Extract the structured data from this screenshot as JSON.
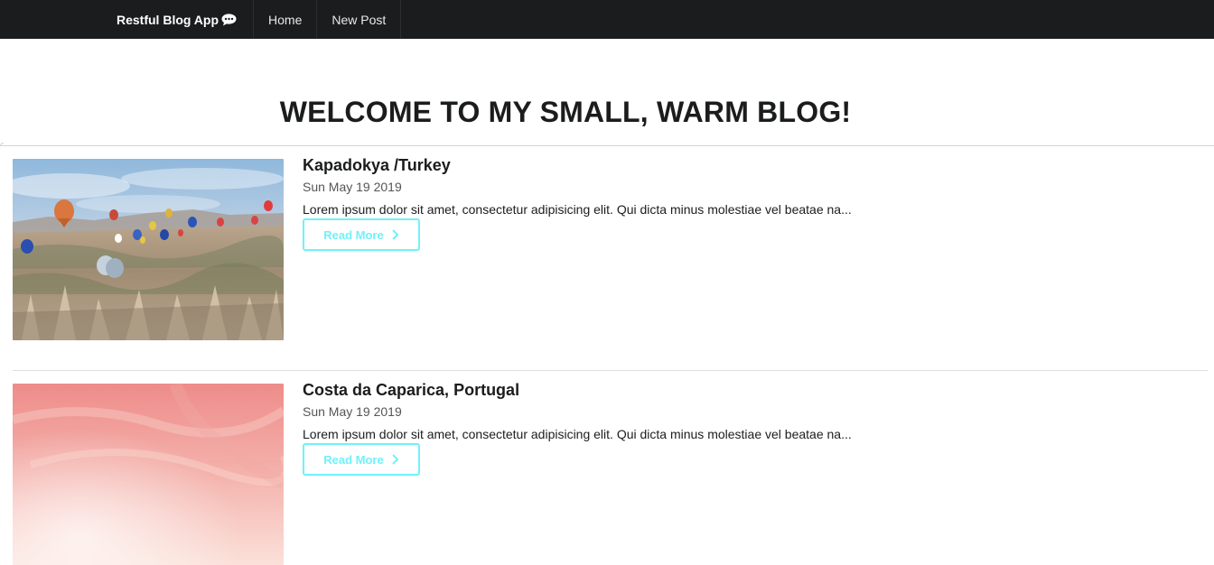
{
  "nav": {
    "brand": "Restful Blog App",
    "brand_icon": "comment-dots-icon",
    "items": [
      {
        "label": "Home"
      },
      {
        "label": "New Post"
      }
    ]
  },
  "page": {
    "title": "WELCOME TO MY SMALL, WARM BLOG!"
  },
  "posts": [
    {
      "title": "Kapadokya /Turkey",
      "date": "Sun May 19 2019",
      "excerpt": "Lorem ipsum dolor sit amet, consectetur adipisicing elit. Qui dicta minus molestiae vel beatae na...",
      "button": "Read More",
      "image": "hot-air-balloons-landscape"
    },
    {
      "title": "Costa da Caparica, Portugal",
      "date": "Sun May 19 2019",
      "excerpt": "Lorem ipsum dolor sit amet, consectetur adipisicing elit. Qui dicta minus molestiae vel beatae na...",
      "button": "Read More",
      "image": "pink-sky"
    }
  ],
  "colors": {
    "navbar": "#1b1c1d",
    "button_accent": "#6ff2f9",
    "divider": "#d4d4d5"
  }
}
